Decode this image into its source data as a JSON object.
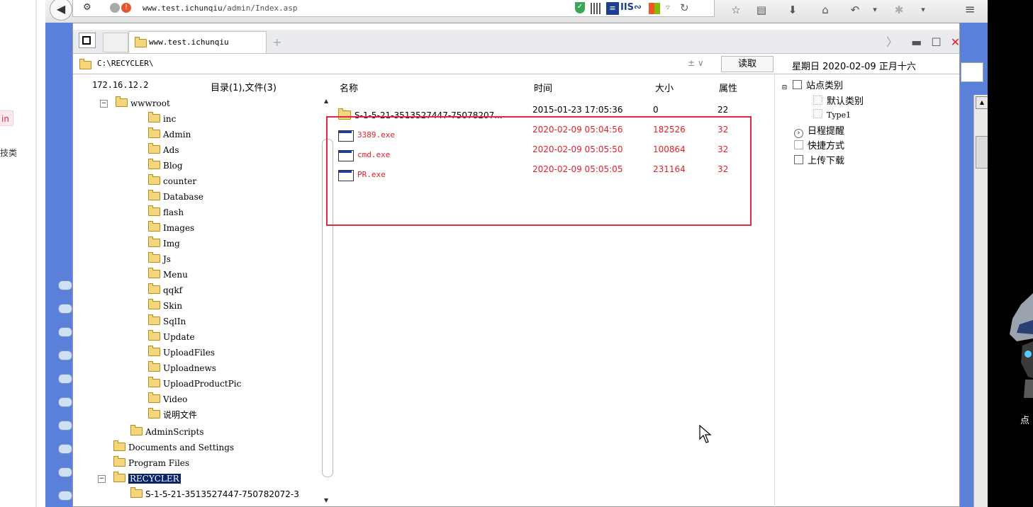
{
  "left_page": {
    "fragment_admin": "in",
    "fragment_category": "技类"
  },
  "browser": {
    "url_host": "www.test.ichunqiu",
    "url_path": "/admin/Index.asp",
    "back_icon": "back-arrow-icon"
  },
  "tabs": [
    {
      "label": "www.test.ichunqiu"
    }
  ],
  "address": {
    "path": "C:\\RECYCLER\\",
    "dropdown": "± ∨",
    "read_button": "读取"
  },
  "date": "星期日 2020-02-09 正月十六",
  "tree": {
    "ip": "172.16.12.2",
    "count_label": "目录(1),文件(3)",
    "nodes": [
      {
        "label": "wwwroot",
        "level": 2,
        "expanded": true
      },
      {
        "label": "inc",
        "level": 3
      },
      {
        "label": "Admin",
        "level": 3
      },
      {
        "label": "Ads",
        "level": 3
      },
      {
        "label": "Blog",
        "level": 3
      },
      {
        "label": "counter",
        "level": 3
      },
      {
        "label": "Database",
        "level": 3
      },
      {
        "label": "flash",
        "level": 3
      },
      {
        "label": "Images",
        "level": 3
      },
      {
        "label": "Img",
        "level": 3
      },
      {
        "label": "Js",
        "level": 3
      },
      {
        "label": "Menu",
        "level": 3
      },
      {
        "label": "qqkf",
        "level": 3
      },
      {
        "label": "Skin",
        "level": 3
      },
      {
        "label": "SqlIn",
        "level": 3
      },
      {
        "label": "Update",
        "level": 3
      },
      {
        "label": "UploadFiles",
        "level": 3
      },
      {
        "label": "Uploadnews",
        "level": 3
      },
      {
        "label": "UploadProductPic",
        "level": 3
      },
      {
        "label": "Video",
        "level": 3
      },
      {
        "label": "说明文件",
        "level": 3
      },
      {
        "label": "AdminScripts",
        "level": 2
      },
      {
        "label": "Documents and Settings",
        "level": 1
      },
      {
        "label": "Program Files",
        "level": 1
      },
      {
        "label": "RECYCLER",
        "level": 1,
        "expanded": true,
        "selected": true
      },
      {
        "label": "S-1-5-21-3513527447-750782072-3",
        "level": 2
      }
    ]
  },
  "files": {
    "headers": {
      "name": "名称",
      "time": "时间",
      "size": "大小",
      "attr": "属性"
    },
    "rows": [
      {
        "name": "S-1-5-21-3513527447-75078207...",
        "time": "2015-01-23 17:05:36",
        "size": "0",
        "attr": "22",
        "type": "folder",
        "highlight": false
      },
      {
        "name": "3389.exe",
        "time": "2020-02-09 05:04:56",
        "size": "182526",
        "attr": "32",
        "type": "exe",
        "highlight": true
      },
      {
        "name": "cmd.exe",
        "time": "2020-02-09 05:05:50",
        "size": "100864",
        "attr": "32",
        "type": "exe",
        "highlight": true
      },
      {
        "name": "PR.exe",
        "time": "2020-02-09 05:05:05",
        "size": "231164",
        "attr": "32",
        "type": "exe",
        "highlight": true
      }
    ]
  },
  "right_tree": {
    "site_category": "站点类别",
    "default_category": "默认类别",
    "type1": "Type1",
    "schedule": "日程提醒",
    "shortcut": "快捷方式",
    "upload_download": "上传下载"
  },
  "side_label": "点"
}
